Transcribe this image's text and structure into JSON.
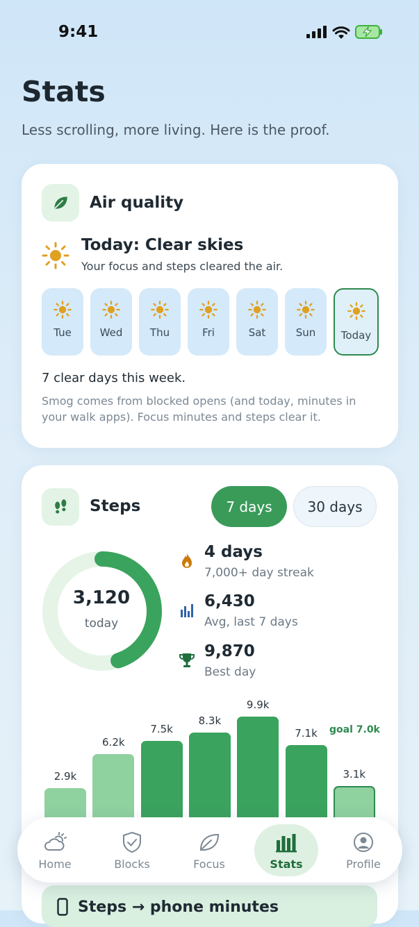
{
  "status_bar": {
    "time": "9:41"
  },
  "header": {
    "title": "Stats",
    "subtitle": "Less scrolling, more living. Here is the proof."
  },
  "air_quality": {
    "title": "Air quality",
    "icon": "leaf-icon",
    "headline": "Today: Clear skies",
    "subline": "Your focus and steps cleared the air.",
    "days": [
      {
        "label": "Tue"
      },
      {
        "label": "Wed"
      },
      {
        "label": "Thu"
      },
      {
        "label": "Fri"
      },
      {
        "label": "Sat"
      },
      {
        "label": "Sun"
      },
      {
        "label": "Today",
        "selected": true
      }
    ],
    "summary": "7 clear days this week.",
    "note": "Smog comes from blocked opens (and today, minutes in your walk apps). Focus minutes and steps clear it."
  },
  "steps": {
    "title": "Steps",
    "icon": "footprints-icon",
    "range_options": [
      "7 days",
      "30 days"
    ],
    "selected_range": "7 days",
    "today_value": "3,120",
    "today_label": "today",
    "progress_fraction": 0.45,
    "stats": [
      {
        "icon": "flame-icon",
        "value": "4 days",
        "label": "7,000+ day streak"
      },
      {
        "icon": "bar-chart-icon",
        "value": "6,430",
        "label": "Avg, last 7 days"
      },
      {
        "icon": "trophy-icon",
        "value": "9,870",
        "label": "Best day"
      }
    ],
    "goal_label": "goal 7.0k"
  },
  "chart_data": {
    "type": "bar",
    "values": [
      2900,
      6200,
      7500,
      8300,
      9900,
      7100,
      3100
    ],
    "value_labels": [
      "2.9k",
      "6.2k",
      "7.5k",
      "8.3k",
      "9.9k",
      "7.1k",
      "3.1k"
    ],
    "goal": 7000,
    "annotations": [
      "goal 7.0k"
    ]
  },
  "partial_card": {
    "title": "Steps → phone minutes"
  },
  "tab_bar": {
    "items": [
      {
        "label": "Home",
        "icon": "weather-icon"
      },
      {
        "label": "Blocks",
        "icon": "shield-icon"
      },
      {
        "label": "Focus",
        "icon": "leaf-icon"
      },
      {
        "label": "Stats",
        "icon": "bar-chart-icon",
        "active": true
      },
      {
        "label": "Profile",
        "icon": "user-icon"
      }
    ]
  },
  "colors": {
    "accent_green": "#3a9b59",
    "sun": "#e0a020"
  }
}
